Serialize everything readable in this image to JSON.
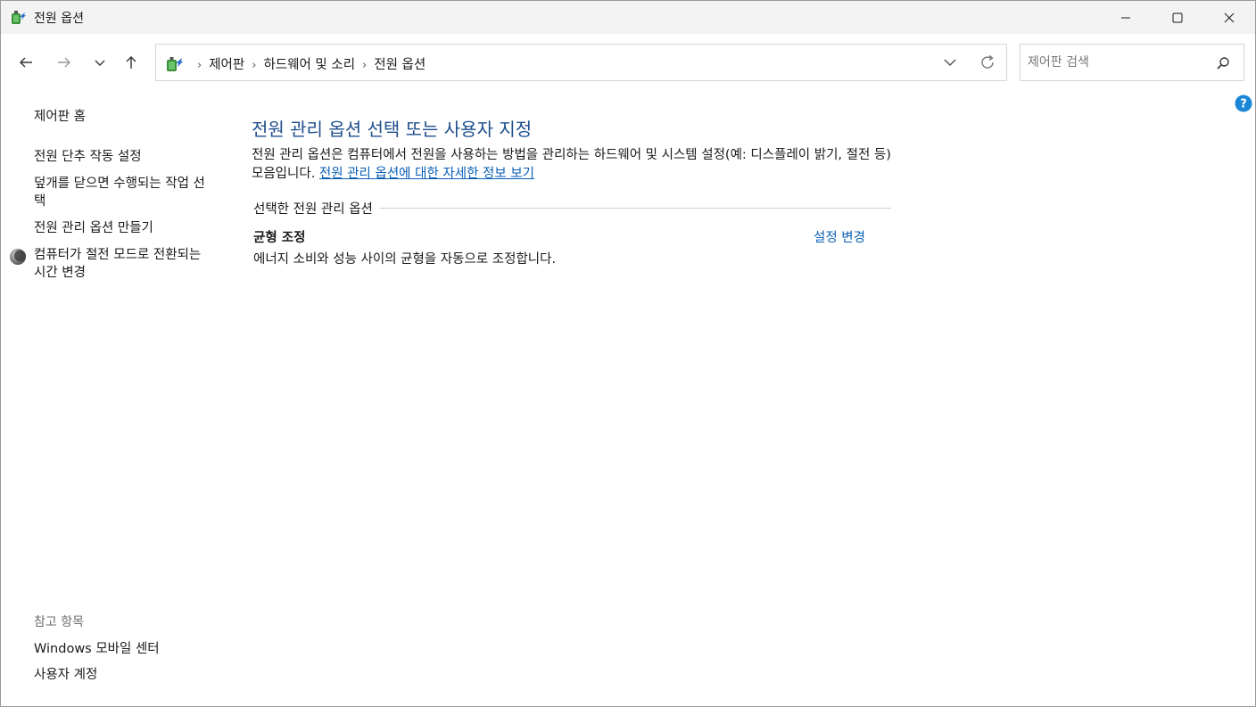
{
  "window": {
    "title": "전원 옵션",
    "app_icon": "power-options-icon",
    "controls": [
      "minimize-icon",
      "maximize-icon",
      "close-icon"
    ]
  },
  "nav": {
    "buttons": [
      "back-arrow-icon",
      "forward-arrow-icon",
      "recent-locations-icon",
      "up-arrow-icon"
    ]
  },
  "address": {
    "crumbs": [
      "제어판",
      "하드웨어 및 소리",
      "전원 옵션"
    ],
    "separator": "›"
  },
  "search": {
    "placeholder": "제어판 검색",
    "value": ""
  },
  "sidebar": {
    "home": "제어판 홈",
    "items": [
      {
        "label": "전원 단추 작동 설정"
      },
      {
        "label": "덮개를 닫으면 수행되는 작업 선택"
      },
      {
        "label": "전원 관리 옵션 만들기"
      },
      {
        "label": "컴퓨터가 절전 모드로 전환되는 시간 변경",
        "icon": "sleep-moon-icon"
      }
    ],
    "see_also_heading": "참고 항목",
    "see_also": [
      {
        "label": "Windows 모바일 센터"
      },
      {
        "label": "사용자 계정"
      }
    ]
  },
  "main": {
    "title": "전원 관리 옵션 선택 또는 사용자 지정",
    "description": "전원 관리 옵션은 컴퓨터에서 전원을 사용하는 방법을 관리하는 하드웨어 및 시스템 설정(예: 디스플레이 밝기, 절전 등) 모음입니다. ",
    "more_info_link": "전원 관리 옵션에 대한 자세한 정보 보기",
    "section_heading": "선택한 전원 관리 옵션",
    "plan": {
      "name": "균형 조정",
      "description": "에너지 소비와 성능 사이의 균형을 자동으로 조정합니다.",
      "change_link": "설정 변경"
    }
  },
  "colors": {
    "title_blue": "#1e4e8c",
    "link_blue": "#0a5fb4",
    "help_blue": "#1a86d8"
  }
}
